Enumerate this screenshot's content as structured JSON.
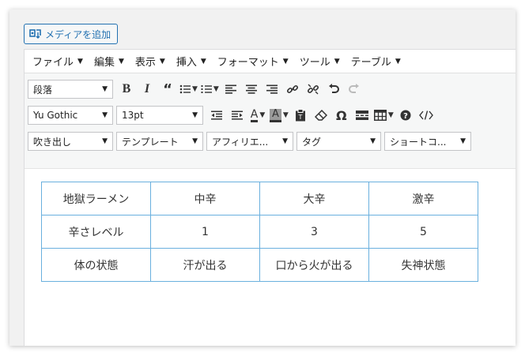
{
  "add_media": {
    "label": "メディアを追加",
    "icon": "media-icon"
  },
  "menubar": {
    "items": [
      "ファイル",
      "編集",
      "表示",
      "挿入",
      "フォーマット",
      "ツール",
      "テーブル"
    ]
  },
  "toolbar": {
    "format_select": "段落",
    "font_select": "Yu Gothic",
    "size_select": "13pt",
    "shortcodes": [
      "吹き出し",
      "テンプレート",
      "アフィリエ...",
      "タグ",
      "ショートコ..."
    ]
  },
  "table": {
    "rows": [
      [
        "地獄ラーメン",
        "中辛",
        "大辛",
        "激辛"
      ],
      [
        "辛さレベル",
        "1",
        "3",
        "5"
      ],
      [
        "体の状態",
        "汗が出る",
        "口から火が出る",
        "失神状態"
      ]
    ]
  },
  "colors": {
    "accent": "#2271b1",
    "table_border": "#6ab0de"
  }
}
